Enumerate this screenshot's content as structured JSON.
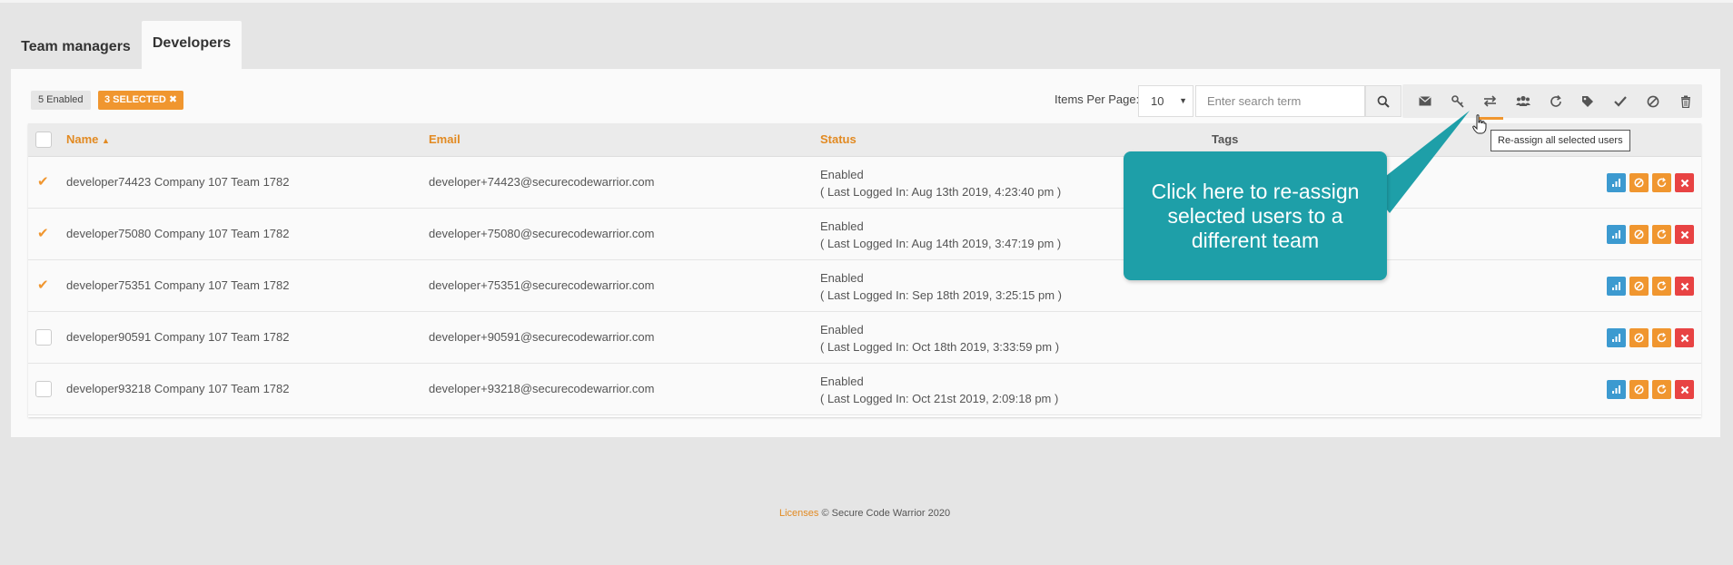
{
  "tabs": [
    {
      "label": "Team managers",
      "active": false
    },
    {
      "label": "Developers",
      "active": true
    }
  ],
  "toolbar": {
    "enabled_badge": "5 Enabled",
    "selected_badge": "3 SELECTED",
    "items_per_page_label": "Items Per Page:",
    "items_per_page_value": "10",
    "search_placeholder": "Enter search term",
    "icons": [
      "envelope-icon",
      "key-icon",
      "reassign-icon",
      "group-icon",
      "refresh-icon",
      "tag-icon",
      "check-icon",
      "disable-icon",
      "trash-icon"
    ],
    "active_icon": "reassign-icon"
  },
  "table": {
    "columns": {
      "name": "Name",
      "email": "Email",
      "status": "Status",
      "tags": "Tags"
    },
    "rows": [
      {
        "name": "developer74423 Company 107 Team 1782",
        "email": "developer+74423@securecodewarrior.com",
        "status": "Enabled",
        "last_login": "( Last Logged In: Aug 13th 2019, 4:23:40 pm )",
        "selected": true
      },
      {
        "name": "developer75080 Company 107 Team 1782",
        "email": "developer+75080@securecodewarrior.com",
        "status": "Enabled",
        "last_login": "( Last Logged In: Aug 14th 2019, 3:47:19 pm )",
        "selected": true
      },
      {
        "name": "developer75351 Company 107 Team 1782",
        "email": "developer+75351@securecodewarrior.com",
        "status": "Enabled",
        "last_login": "( Last Logged In: Sep 18th 2019, 3:25:15 pm )",
        "selected": true
      },
      {
        "name": "developer90591 Company 107 Team 1782",
        "email": "developer+90591@securecodewarrior.com",
        "status": "Enabled",
        "last_login": "( Last Logged In: Oct 18th 2019, 3:33:59 pm )",
        "selected": false
      },
      {
        "name": "developer93218 Company 107 Team 1782",
        "email": "developer+93218@securecodewarrior.com",
        "status": "Enabled",
        "last_login": "( Last Logged In: Oct 21st 2019, 2:09:18 pm )",
        "selected": false
      }
    ]
  },
  "tooltip": "Re-assign all selected users",
  "callout": "Click here to re-assign selected users to a different team",
  "footer": {
    "link": "Licenses",
    "text": "© Secure Code Warrior 2020"
  },
  "colors": {
    "accent": "#f0962f",
    "callout": "#1e9fa8",
    "stats": "#3c9ad0",
    "delete": "#e84343"
  }
}
